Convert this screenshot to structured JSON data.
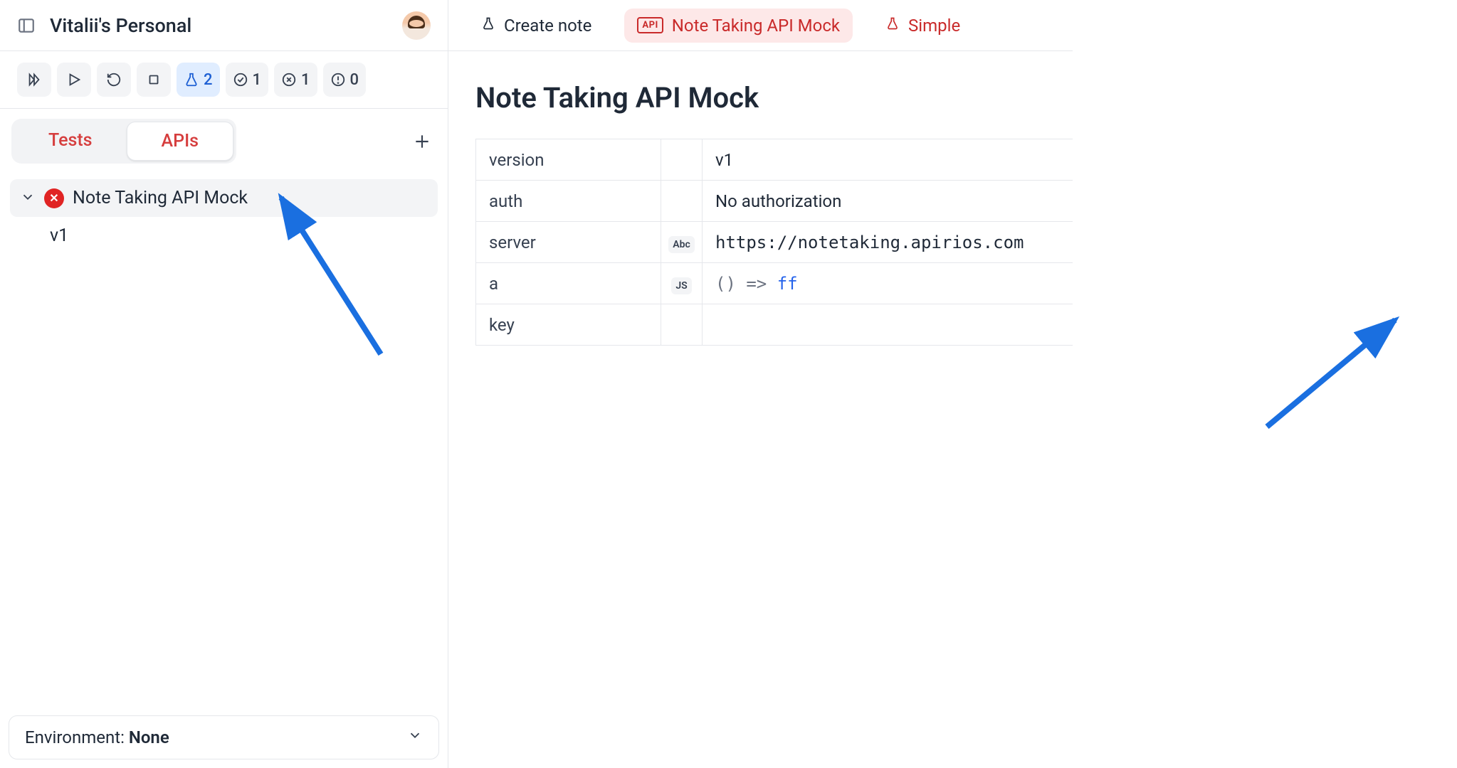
{
  "sidebar": {
    "workspace_name": "Vitalii's Personal",
    "toolbar": {
      "run_all": "",
      "play": "",
      "refresh": "",
      "stop": "",
      "flask_count": "2",
      "check_count": "1",
      "fail_count": "1",
      "warn_count": "0"
    },
    "tabs": {
      "tests": "Tests",
      "apis": "APIs"
    },
    "tree": {
      "root_label": "Note Taking API Mock",
      "child_label": "v1"
    },
    "environment_prefix": "Environment: ",
    "environment_value": "None"
  },
  "main": {
    "tabs": {
      "create_note": "Create note",
      "api_badge": "API",
      "api_mock": "Note Taking API Mock",
      "simple": "Simple"
    },
    "title": "Note Taking API Mock",
    "rows": {
      "version_key": "version",
      "version_val": "v1",
      "auth_key": "auth",
      "auth_val": "No authorization",
      "server_key": "server",
      "server_type": "Abc",
      "server_val": "https://notetaking.apirios.com",
      "a_key": "a",
      "a_type": "JS",
      "a_val_open": "()",
      "a_val_arrow": "=>",
      "a_val_fn": "ff",
      "empty_key": "key"
    }
  }
}
